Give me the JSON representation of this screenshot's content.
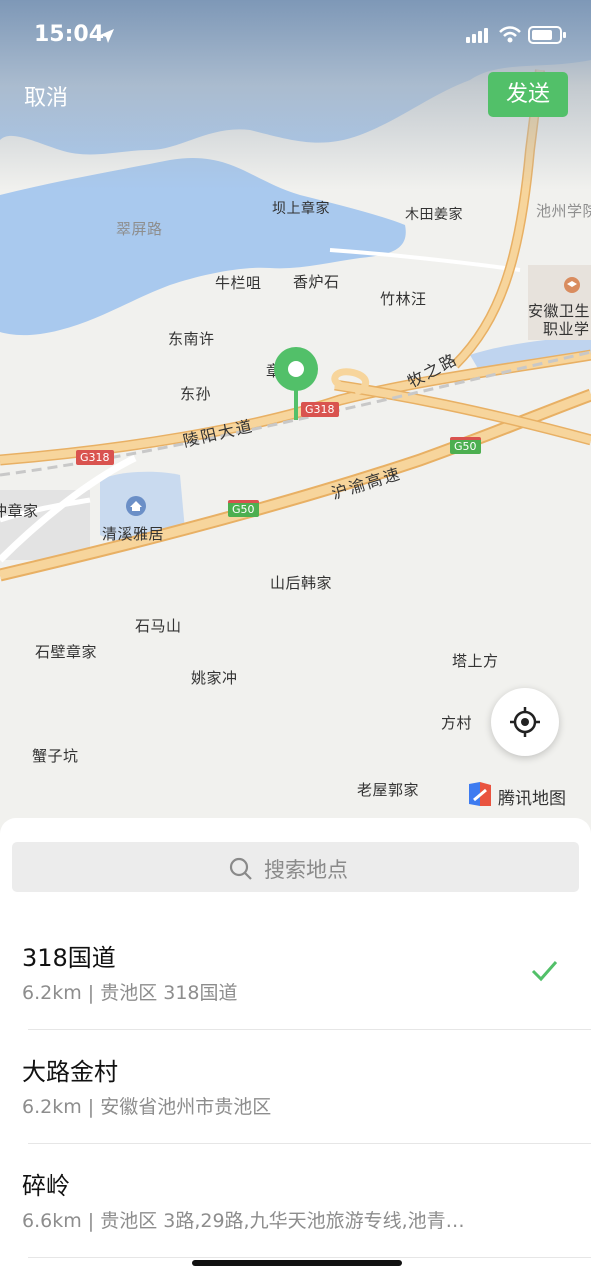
{
  "status_bar": {
    "time": "15:04"
  },
  "header": {
    "cancel_label": "取消",
    "send_label": "发送"
  },
  "map": {
    "labels": {
      "cuipinglu": "翠屏路",
      "bashangzhangjia": "坝上章家",
      "mutianjiangjia": "木田姜家",
      "chizhouxueyuan": "池州学院",
      "niulanju": "牛栏咀",
      "xianglushi": "香炉石",
      "zhulinwang": "竹林汪",
      "anhuiweisheng": "安徽卫生",
      "zhiyexueyuan": "职业学",
      "dongnanxu": "东南许",
      "dongsun": "东孙",
      "qingxiyaju": "清溪雅居",
      "chongzhangjia": "冲章家",
      "shanhouhanjia": "山后韩家",
      "shimashan": "石马山",
      "shibizhangjia": "石壁章家",
      "tashangfang": "塔上方",
      "yaojiachong": "姚家冲",
      "fangcun": "方村",
      "xiezikeng": "蟹子坑",
      "laowuguojia": "老屋郭家",
      "zhang_partial": "章"
    },
    "roads": {
      "lingyang": "陵阳大道",
      "muzhi": "牧之路",
      "huyu": "沪渝高速"
    },
    "shields": {
      "g318": "G318",
      "g50": "G50"
    },
    "provider": "腾讯地图"
  },
  "search": {
    "placeholder": "搜索地点"
  },
  "results": [
    {
      "title": "318国道",
      "subtitle": "6.2km | 贵池区 318国道",
      "selected": true
    },
    {
      "title": "大路金村",
      "subtitle": "6.2km | 安徽省池州市贵池区",
      "selected": false
    },
    {
      "title": "碎岭",
      "subtitle": "6.6km | 贵池区 3路,29路,九华天池旅游专线,池青…",
      "selected": false
    }
  ],
  "colors": {
    "accent": "#52c069",
    "water": "#a9c9ee",
    "highway": "#f4c27f"
  }
}
